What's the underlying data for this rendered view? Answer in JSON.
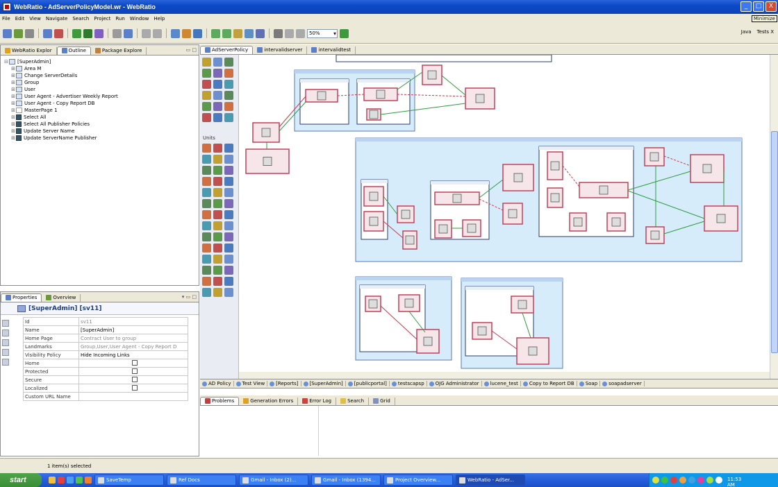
{
  "window": {
    "title": "WebRatio - AdServerPolicyModel.wr - WebRatio",
    "tooltip": "Minimize",
    "min": "_",
    "max": "□",
    "close": "X"
  },
  "menu": [
    "File",
    "Edit",
    "View",
    "Navigate",
    "Search",
    "Project",
    "Run",
    "Window",
    "Help"
  ],
  "toolbar": {
    "zoom": "50%",
    "perspectives": [
      "Java",
      "Tests X"
    ]
  },
  "left_tabs": [
    {
      "label": "WebRatio Explor"
    },
    {
      "label": "Outline"
    },
    {
      "label": "Package Explore"
    }
  ],
  "tree": [
    {
      "expander": "⊟",
      "indent": 0,
      "icon": "site-view",
      "label": "[SuperAdmin]"
    },
    {
      "expander": "⊞",
      "indent": 1,
      "icon": "area",
      "label": "Area M"
    },
    {
      "expander": "⊞",
      "indent": 1,
      "icon": "area",
      "label": "Change ServerDetails"
    },
    {
      "expander": "⊞",
      "indent": 1,
      "icon": "area",
      "label": "Group"
    },
    {
      "expander": "⊞",
      "indent": 1,
      "icon": "area",
      "label": "User"
    },
    {
      "expander": "⊞",
      "indent": 1,
      "icon": "area",
      "label": "User Agent - Advertiser Weekly Report"
    },
    {
      "expander": "⊞",
      "indent": 1,
      "icon": "area",
      "label": "User Agent - Copy Report DB"
    },
    {
      "expander": "⊞",
      "indent": 1,
      "icon": "page",
      "label": "MasterPage 1"
    },
    {
      "expander": "⊞",
      "indent": 1,
      "icon": "operation",
      "label": "Select All"
    },
    {
      "expander": "⊞",
      "indent": 1,
      "icon": "operation",
      "label": "Select All Publisher Policies"
    },
    {
      "expander": "⊞",
      "indent": 1,
      "icon": "operation",
      "label": "Update Server Name"
    },
    {
      "expander": "⊞",
      "indent": 1,
      "icon": "operation",
      "label": "Update ServerName Publisher"
    }
  ],
  "props_tabs": [
    {
      "label": "Properties"
    },
    {
      "label": "Overview"
    }
  ],
  "properties": {
    "header": "[SuperAdmin] [sv11]",
    "rows": [
      {
        "key": "Id",
        "value": "sv11",
        "dim": true,
        "checkbox": false
      },
      {
        "key": "Name",
        "value": "[SuperAdmin]",
        "dim": false,
        "checkbox": false
      },
      {
        "key": "Home Page",
        "value": "Contract User to group",
        "dim": true,
        "checkbox": false
      },
      {
        "key": "Landmarks",
        "value": "Group,User,User Agent - Copy Report D",
        "dim": true,
        "checkbox": false
      },
      {
        "key": "Visibility Policy",
        "value": "Hide Incoming Links",
        "dim": false,
        "checkbox": false
      },
      {
        "key": "Home",
        "value": "",
        "dim": false,
        "checkbox": true
      },
      {
        "key": "Protected",
        "value": "",
        "dim": false,
        "checkbox": true
      },
      {
        "key": "Secure",
        "value": "",
        "dim": false,
        "checkbox": true
      },
      {
        "key": "Localized",
        "value": "",
        "dim": false,
        "checkbox": true
      },
      {
        "key": "Custom URL Name",
        "value": "",
        "dim": false,
        "checkbox": false
      }
    ]
  },
  "palette": {
    "label": "Units"
  },
  "editor_tabs": [
    {
      "label": "AdServerPolicy"
    },
    {
      "label": "intervalidserver"
    },
    {
      "label": "intervalidtest"
    }
  ],
  "sheet_tabs": [
    "AD Policy",
    "Test View",
    "[Reports]",
    "[SuperAdmin]",
    "[publicportal]",
    "testscapsp",
    "OJG Administrator",
    "lucene_test",
    "Copy to Report DB",
    "Soap",
    "soapadserver"
  ],
  "bottom_tabs": [
    {
      "label": "Problems"
    },
    {
      "label": "Generation Errors"
    },
    {
      "label": "Error Log"
    },
    {
      "label": "Search"
    },
    {
      "label": "Grid"
    }
  ],
  "status": {
    "text": "1 item(s) selected"
  },
  "taskbar": {
    "start": "start",
    "tasks": [
      "SaveTemp",
      "Ref Docs",
      "Gmail - Inbox (2)...",
      "Gmail - Inbox (1394...",
      "Project Overview...",
      "WebRatio - AdSer..."
    ],
    "clock": "11:53 AM"
  },
  "colors": {
    "titlebar": "#0b49c7",
    "chrome": "#ece9d8",
    "diagram_fill": "#d6ecfa",
    "unit_border": "#c0405a",
    "link_green": "#2e9b3e",
    "link_red": "#c8384a"
  }
}
